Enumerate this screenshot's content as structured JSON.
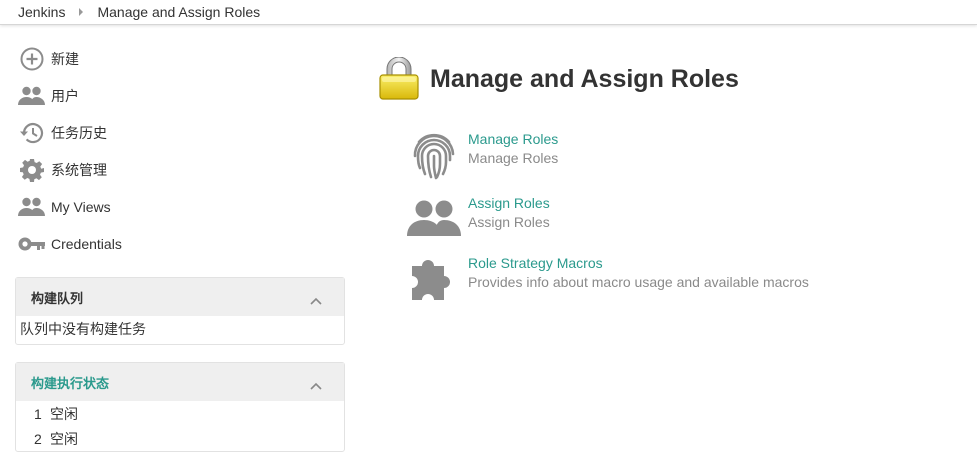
{
  "breadcrumb": {
    "root": "Jenkins",
    "current": "Manage and Assign Roles"
  },
  "tasks": [
    {
      "label": "新建",
      "icon": "plus-circle-icon"
    },
    {
      "label": "用户",
      "icon": "users-icon"
    },
    {
      "label": "任务历史",
      "icon": "history-icon"
    },
    {
      "label": "系统管理",
      "icon": "gear-icon"
    },
    {
      "label": "My Views",
      "icon": "users-icon"
    },
    {
      "label": "Credentials",
      "icon": "key-icon"
    }
  ],
  "build_queue": {
    "title": "构建队列",
    "empty_text": "队列中没有构建任务"
  },
  "executors": {
    "title": "构建执行状态",
    "rows": [
      {
        "num": "1",
        "status": "空闲"
      },
      {
        "num": "2",
        "status": "空闲"
      }
    ]
  },
  "main": {
    "title": "Manage and Assign Roles",
    "items": [
      {
        "title": "Manage Roles",
        "desc": "Manage Roles",
        "icon": "fingerprint-icon"
      },
      {
        "title": "Assign Roles",
        "desc": "Assign Roles",
        "icon": "users-icon"
      },
      {
        "title": "Role Strategy Macros",
        "desc": "Provides info about macro usage and available macros",
        "icon": "puzzle-icon"
      }
    ]
  },
  "colors": {
    "link": "#2b9a8d",
    "icon_gray": "#8c8c8c",
    "pane_header_bg": "#efefef",
    "lock_yellow": "#f2dc1d"
  }
}
